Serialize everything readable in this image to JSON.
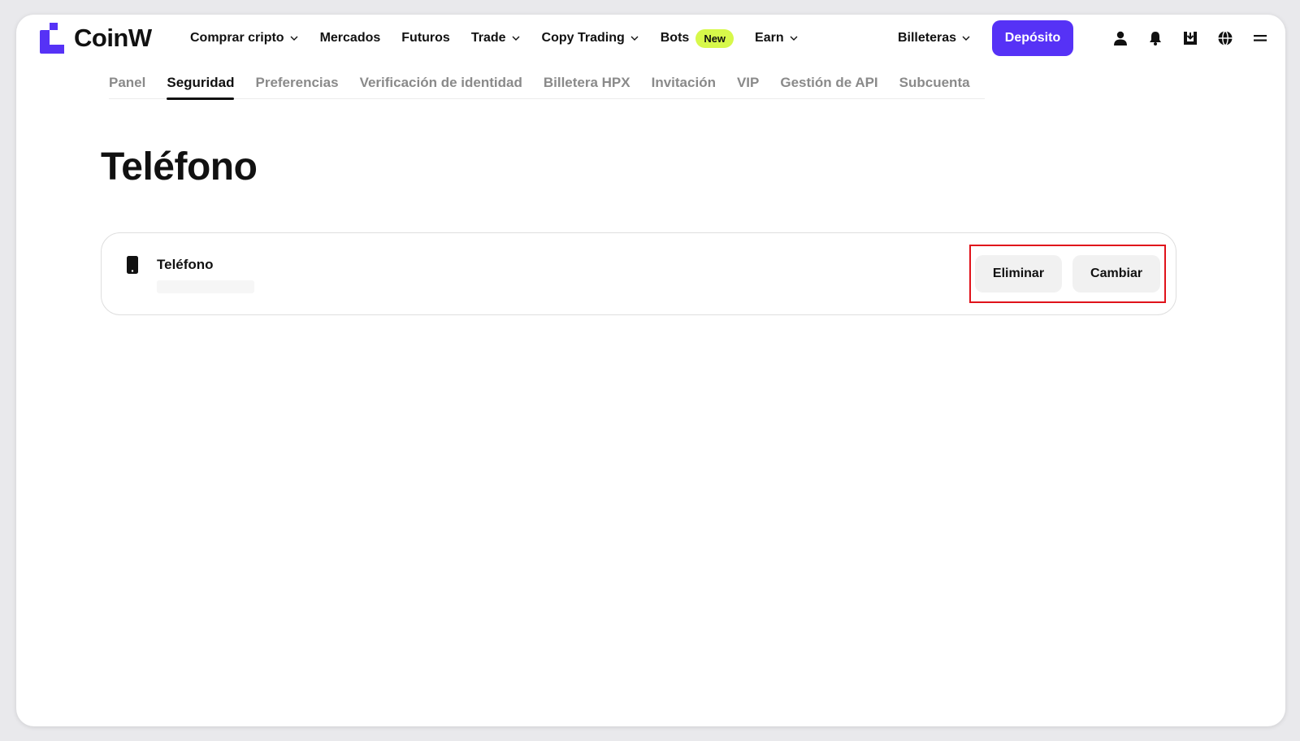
{
  "brand": {
    "name": "CoinW",
    "accent": "#5632f6",
    "new_badge_color": "#d7f84a",
    "highlight_color": "#e0131b"
  },
  "nav": {
    "items": [
      {
        "label": "Comprar cripto",
        "dropdown": true
      },
      {
        "label": "Mercados",
        "dropdown": false
      },
      {
        "label": "Futuros",
        "dropdown": false
      },
      {
        "label": "Trade",
        "dropdown": true
      },
      {
        "label": "Copy Trading",
        "dropdown": true
      },
      {
        "label": "Bots",
        "dropdown": false,
        "badge": "New"
      },
      {
        "label": "Earn",
        "dropdown": true
      }
    ],
    "wallets_label": "Billeteras",
    "deposit_label": "Depósito",
    "icons": [
      "user-icon",
      "bell-icon",
      "download-icon",
      "globe-icon",
      "menu-icon"
    ]
  },
  "subtabs": {
    "items": [
      "Panel",
      "Seguridad",
      "Preferencias",
      "Verificación de identidad",
      "Billetera HPX",
      "Invitación",
      "VIP",
      "Gestión de API",
      "Subcuenta"
    ],
    "active": "Seguridad"
  },
  "page": {
    "title": "Teléfono",
    "card": {
      "label": "Teléfono",
      "value": "",
      "delete_label": "Eliminar",
      "change_label": "Cambiar"
    }
  }
}
